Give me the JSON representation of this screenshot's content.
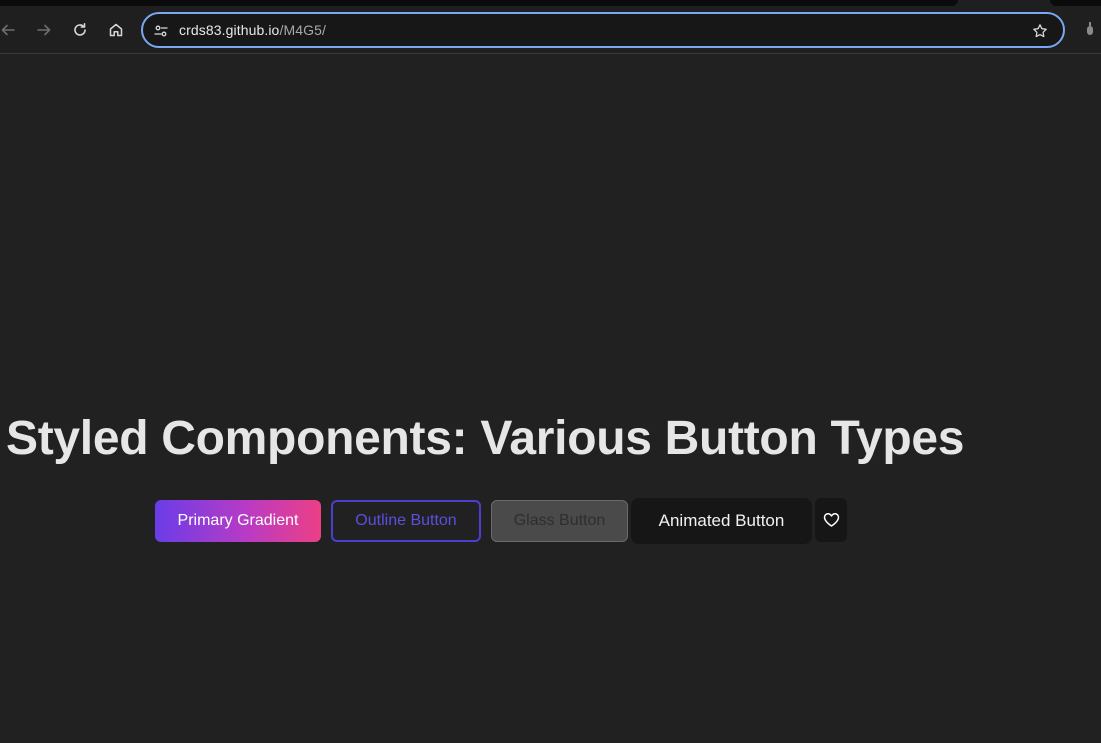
{
  "browser": {
    "url_host": "crds83.github.io",
    "url_path": "/M4G5/",
    "icons": {
      "back": "arrow-left-icon",
      "forward": "arrow-right-icon",
      "reload": "reload-icon",
      "home": "home-icon",
      "site_info": "tune-icon",
      "bookmark": "star-icon",
      "extension": "extension-icon"
    },
    "colors": {
      "focus_ring": "#7aa7f0"
    }
  },
  "page": {
    "title": "Styled Components: Various Button Types",
    "buttons": {
      "primary_gradient": "Primary Gradient",
      "outline": "Outline Button",
      "glass": "Glass Button",
      "animated": "Animated Button",
      "heart_icon": "heart-icon"
    },
    "colors": {
      "background": "#212121",
      "gradient_start": "#6a3de8",
      "gradient_end": "#ec3f86",
      "outline_accent": "#4b3fd1"
    }
  }
}
